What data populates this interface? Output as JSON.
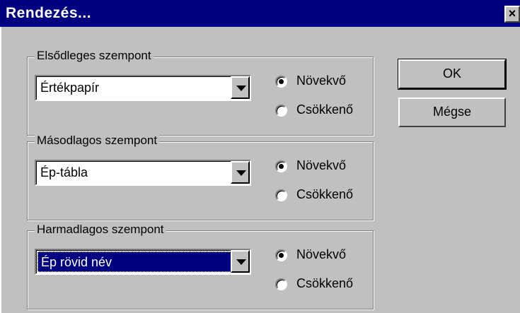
{
  "window": {
    "title": "Rendezés...",
    "close_glyph": "✕"
  },
  "groups": [
    {
      "label": "Elsődleges szempont",
      "combo_value": "Értékpapír",
      "radio_asc": "Növekvő",
      "radio_desc": "Csökkenő",
      "selected": "asc"
    },
    {
      "label": "Másodlagos szempont",
      "combo_value": "Ép-tábla",
      "radio_asc": "Növekvő",
      "radio_desc": "Csökkenő",
      "selected": "asc"
    },
    {
      "label": "Harmadlagos szempont",
      "combo_value": "Ép rövid név",
      "radio_asc": "Növekvő",
      "radio_desc": "Csökkenő",
      "selected": "asc"
    }
  ],
  "buttons": {
    "ok": "OK",
    "cancel": "Mégse"
  }
}
